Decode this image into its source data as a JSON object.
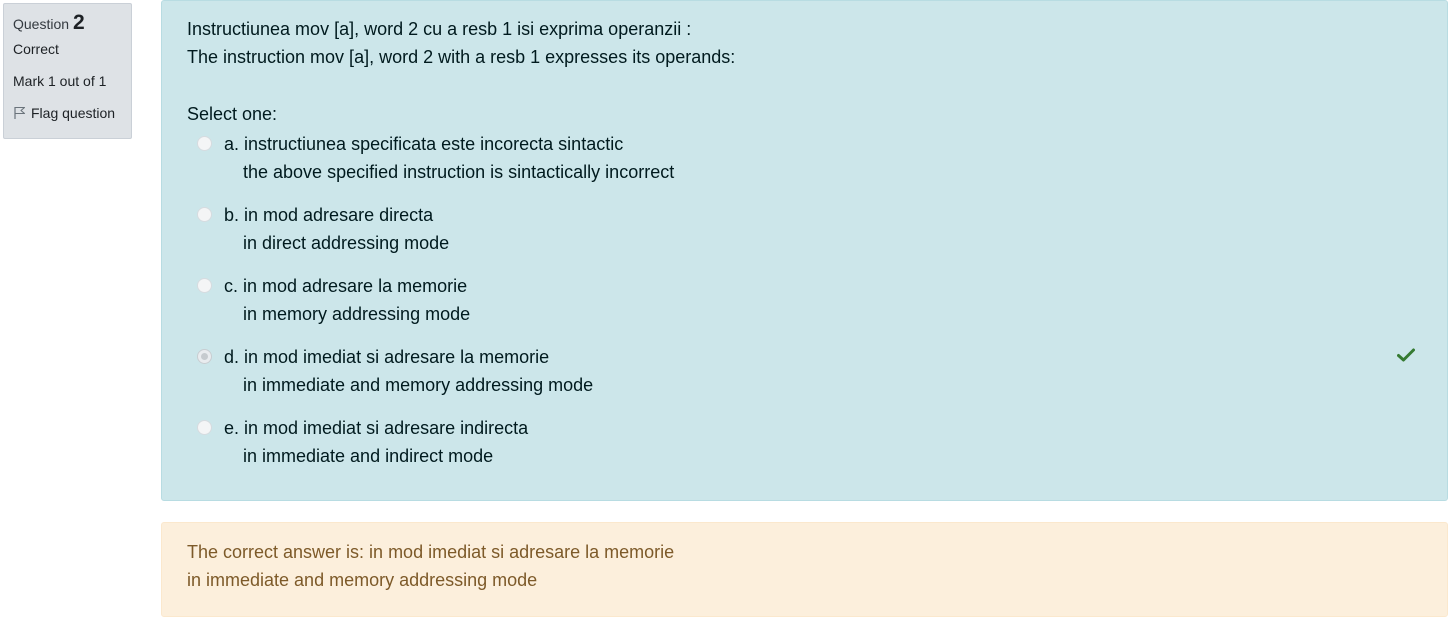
{
  "info": {
    "question_label": "Question",
    "question_number": "2",
    "state": "Correct",
    "grade": "Mark 1 out of 1",
    "flag_label": "Flag question"
  },
  "question": {
    "text_ro": "Instructiunea mov [a], word 2 cu a resb 1 isi exprima operanzii :",
    "text_en": "The instruction mov [a], word 2 with a resb 1 expresses its operands:",
    "prompt": "Select one:",
    "answers": [
      {
        "ro": "a. instructiunea specificata este incorecta sintactic",
        "en": "the above specified instruction is sintactically incorrect",
        "checked": false
      },
      {
        "ro": "b. in mod adresare directa",
        "en": "in direct addressing mode",
        "checked": false
      },
      {
        "ro": "c. in mod adresare la memorie",
        "en": "in memory addressing mode",
        "checked": false
      },
      {
        "ro": "d. in mod imediat si adresare la memorie",
        "en": "in immediate and memory addressing mode",
        "checked": true
      },
      {
        "ro": "e. in mod imediat si adresare indirecta",
        "en": "in immediate and indirect mode",
        "checked": false
      }
    ]
  },
  "feedback": {
    "line1": "The correct answer is: in mod imediat si adresare la memorie",
    "line2": "in immediate and memory addressing mode"
  },
  "colors": {
    "formulation_bg": "#cce6ea",
    "feedback_bg": "#fcefdc",
    "correct_check": "#357a32"
  }
}
